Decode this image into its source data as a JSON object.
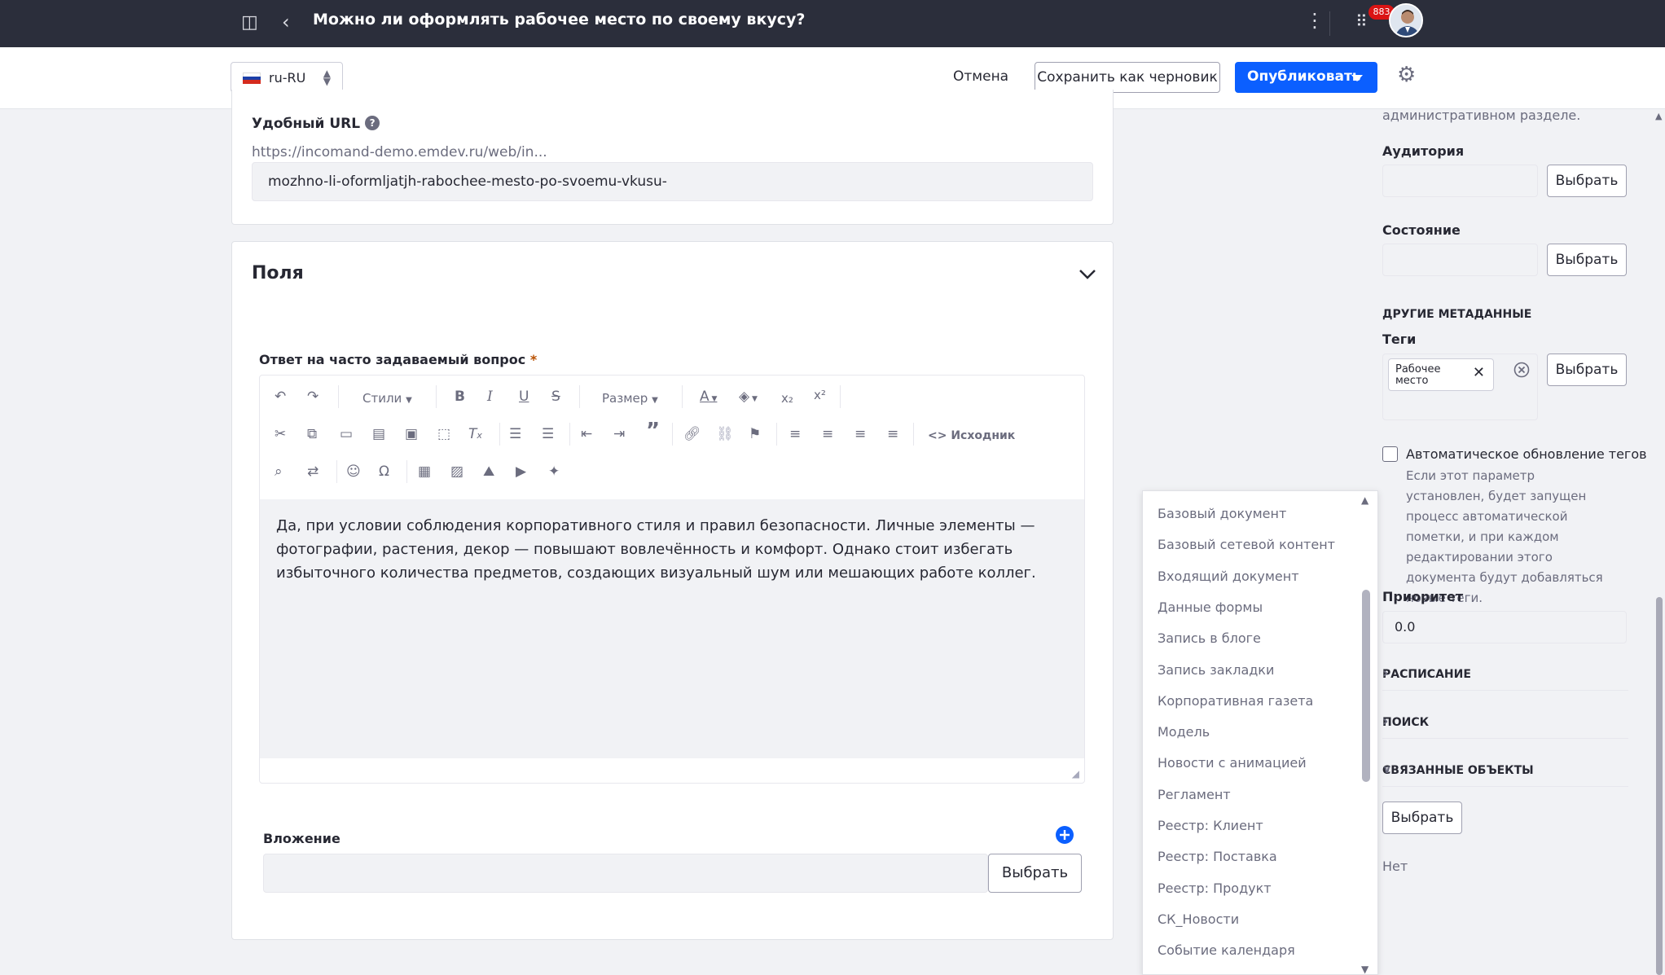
{
  "header": {
    "title": "Можно ли оформлять рабочее место по своему вкусу?",
    "notifications_count": "883"
  },
  "toolbar": {
    "locale": "ru-RU",
    "cancel_label": "Отмена",
    "save_draft_label": "Сохранить как черновик",
    "publish_label": "Опубликовать"
  },
  "url_section": {
    "label": "Удобный URL",
    "help": "?",
    "base_url": "https://incomand-demo.emdev.ru/web/in...",
    "slug": "mozhno-li-oformljatjh-rabochee-mesto-po-svoemu-vkusu-"
  },
  "fields_section": {
    "title": "Поля",
    "answer_label": "Ответ на часто задаваемый вопрос",
    "required_mark": "*",
    "editor": {
      "styles_label": "Стили",
      "size_label": "Размер",
      "source_label": "Исходник",
      "content": "Да, при условии соблюдения корпоративного стиля и правил безопасности. Личные элементы — фотографии, растения, декор — повышают вовлечённость и комфорт. Однако стоит избегать избыточного количества предметов, создающих визуальный шум или мешающих работе коллег."
    },
    "attachment_label": "Вложение",
    "attachment_select": "Выбрать"
  },
  "sidebar": {
    "top_text": "административном разделе.",
    "audience_label": "Аудитория",
    "state_label": "Состояние",
    "select_label": "Выбрать",
    "other_meta_title": "ДРУГИЕ МЕТАДАННЫЕ",
    "tags_label": "Теги",
    "tag_chip": "Рабочее место",
    "auto_tags_label": "Автоматическое обновление тегов",
    "auto_tags_help": "Если этот параметр установлен, будет запущен процесс автоматической пометки, и при каждом редактировании этого документа будут добавляться новые теги.",
    "priority_label": "Приоритет",
    "priority_value": "0.0",
    "sections": [
      "РАСПИСАНИЕ",
      "ПОИСК",
      "СВЯЗАННЫЕ ОБЪЕКТЫ"
    ],
    "related_select": "Выбрать",
    "related_none": "Нет"
  },
  "dropdown_items": [
    "Базовый документ",
    "Базовый сетевой контент",
    "Входящий документ",
    "Данные формы",
    "Запись в блоге",
    "Запись закладки",
    "Корпоративная газета",
    "Модель",
    "Новости с анимацией",
    "Регламент",
    "Реестр: Клиент",
    "Реестр: Поставка",
    "Реестр: Продукт",
    "СК_Новости",
    "Событие календаря"
  ],
  "colors": {
    "topbar": "#2b2e3b",
    "primary": "#0b5fff",
    "badge": "#da1414",
    "required": "#b95000"
  }
}
